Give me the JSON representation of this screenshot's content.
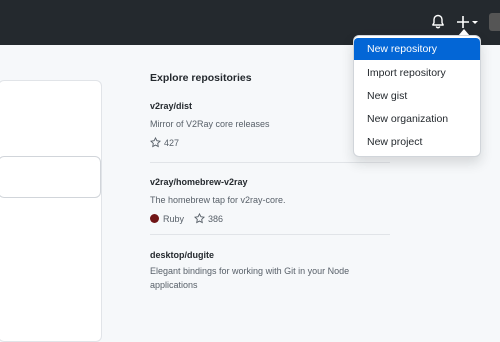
{
  "header": {
    "bell_icon": "bell-icon",
    "plus_icon": "plus-icon",
    "avatar": "avatar"
  },
  "dropdown": {
    "items": [
      {
        "label": "New repository",
        "active": true
      },
      {
        "label": "Import repository",
        "active": false
      },
      {
        "label": "New gist",
        "active": false
      },
      {
        "label": "New organization",
        "active": false
      },
      {
        "label": "New project",
        "active": false
      }
    ],
    "active_color": "#0366d6"
  },
  "explore": {
    "title": "Explore repositories",
    "repos": [
      {
        "name": "v2ray/dist",
        "description": "Mirror of V2Ray core releases",
        "language": "",
        "stars": "427"
      },
      {
        "name": "v2ray/homebrew-v2ray",
        "description": "The homebrew tap for v2ray-core.",
        "language": "Ruby",
        "language_color": "#701516",
        "stars": "386"
      },
      {
        "name": "desktop/dugite",
        "description": "Elegant bindings for working with Git in your Node applications",
        "language": "",
        "stars": ""
      }
    ]
  }
}
